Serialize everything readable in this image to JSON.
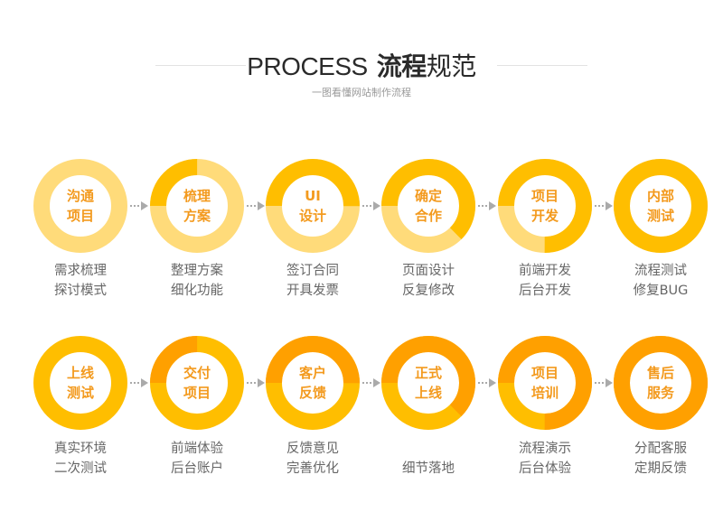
{
  "header": {
    "title_en": "PROCESS",
    "title_cn_bold": "流程",
    "title_cn_normal": "规范",
    "subtitle": "一图看懂网站制作流程"
  },
  "colors": {
    "track_light": "#FFDB7A",
    "fill_gold": "#FFBE00",
    "fill_orange": "#FFA000",
    "label": "#F39A1E",
    "desc": "#666666",
    "arrow": "#AAAAAA"
  },
  "rows": [
    {
      "track_color": "#FFDB7A",
      "fill_color": "#FFBE00",
      "steps": [
        {
          "label": [
            "沟通",
            "项目"
          ],
          "progress": 0,
          "desc": [
            "需求梳理",
            "探讨模式"
          ]
        },
        {
          "label": [
            "梳理",
            "方案"
          ],
          "progress": 0.25,
          "desc": [
            "整理方案",
            "细化功能"
          ]
        },
        {
          "label": [
            "UI",
            "设计"
          ],
          "progress": 0.5,
          "desc": [
            "签订合同",
            "开具发票"
          ]
        },
        {
          "label": [
            "确定",
            "合作"
          ],
          "progress": 0.625,
          "desc": [
            "页面设计",
            "反复修改"
          ]
        },
        {
          "label": [
            "项目",
            "开发"
          ],
          "progress": 0.75,
          "desc": [
            "前端开发",
            "后台开发"
          ]
        },
        {
          "label": [
            "内部",
            "测试"
          ],
          "progress": 1,
          "desc": [
            "流程测试",
            "修复BUG"
          ]
        }
      ]
    },
    {
      "track_color": "#FFBE00",
      "fill_color": "#FFA000",
      "steps": [
        {
          "label": [
            "上线",
            "测试"
          ],
          "progress": 0,
          "desc": [
            "真实环境",
            "二次测试"
          ]
        },
        {
          "label": [
            "交付",
            "项目"
          ],
          "progress": 0.25,
          "desc": [
            "前端体验",
            "后台账户"
          ]
        },
        {
          "label": [
            "客户",
            "反馈"
          ],
          "progress": 0.5,
          "desc": [
            "反馈意见",
            "完善优化"
          ]
        },
        {
          "label": [
            "正式",
            "上线"
          ],
          "progress": 0.625,
          "desc": [
            "",
            "细节落地"
          ]
        },
        {
          "label": [
            "项目",
            "培训"
          ],
          "progress": 0.75,
          "desc": [
            "流程演示",
            "后台体验"
          ]
        },
        {
          "label": [
            "售后",
            "服务"
          ],
          "progress": 1,
          "desc": [
            "分配客服",
            "定期反馈"
          ]
        }
      ]
    }
  ]
}
